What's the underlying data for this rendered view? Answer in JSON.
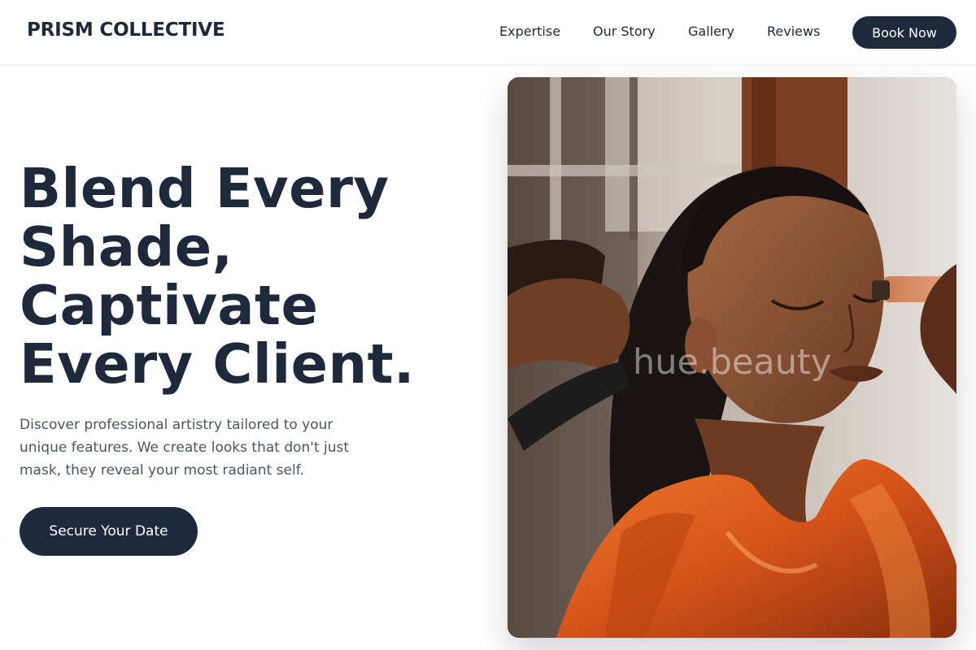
{
  "header": {
    "brand": "PRISM COLLECTIVE",
    "nav": [
      {
        "label": "Expertise"
      },
      {
        "label": "Our Story"
      },
      {
        "label": "Gallery"
      },
      {
        "label": "Reviews"
      }
    ],
    "book_button": "Book Now"
  },
  "hero": {
    "title_lines": [
      "Blend Every",
      "Shade,",
      "Captivate",
      "Every Client."
    ],
    "description_lines": [
      "Discover professional artistry tailored to your",
      "unique features. We create looks that don't just",
      "mask, they reveal your most radiant self."
    ],
    "cta_button": "Secure Your Date"
  },
  "photo": {
    "watermark": "hue.beauty"
  },
  "colors": {
    "primary": "#1e293b",
    "text_muted": "#475569",
    "background": "#ffffff"
  }
}
